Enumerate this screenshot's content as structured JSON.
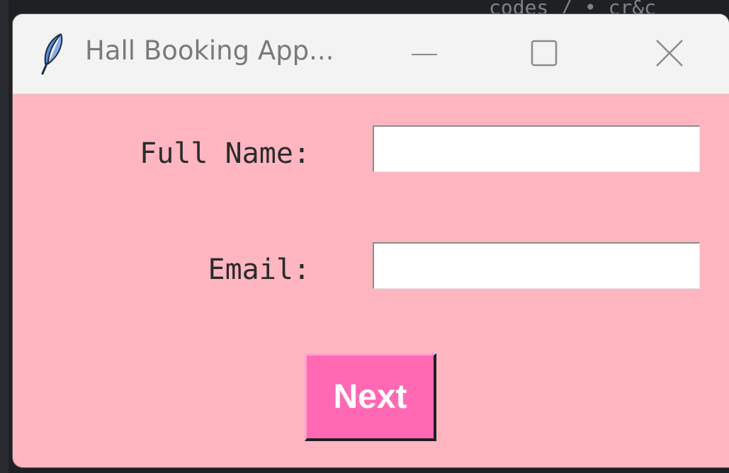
{
  "window": {
    "title": "Hall Booking App..."
  },
  "form": {
    "full_name_label": "Full Name:",
    "full_name_value": "",
    "email_label": "Email:",
    "email_value": "",
    "next_label": "Next"
  },
  "background": {
    "editor_text": "codes / • cr&c"
  },
  "colors": {
    "window_bg": "#ffb6c1",
    "button_bg": "#ff69b4",
    "button_text": "#ffffff",
    "titlebar_bg": "#f3f3f3"
  },
  "icons": {
    "app": "feather-icon",
    "minimize": "minimize-icon",
    "maximize": "maximize-icon",
    "close": "close-icon"
  }
}
